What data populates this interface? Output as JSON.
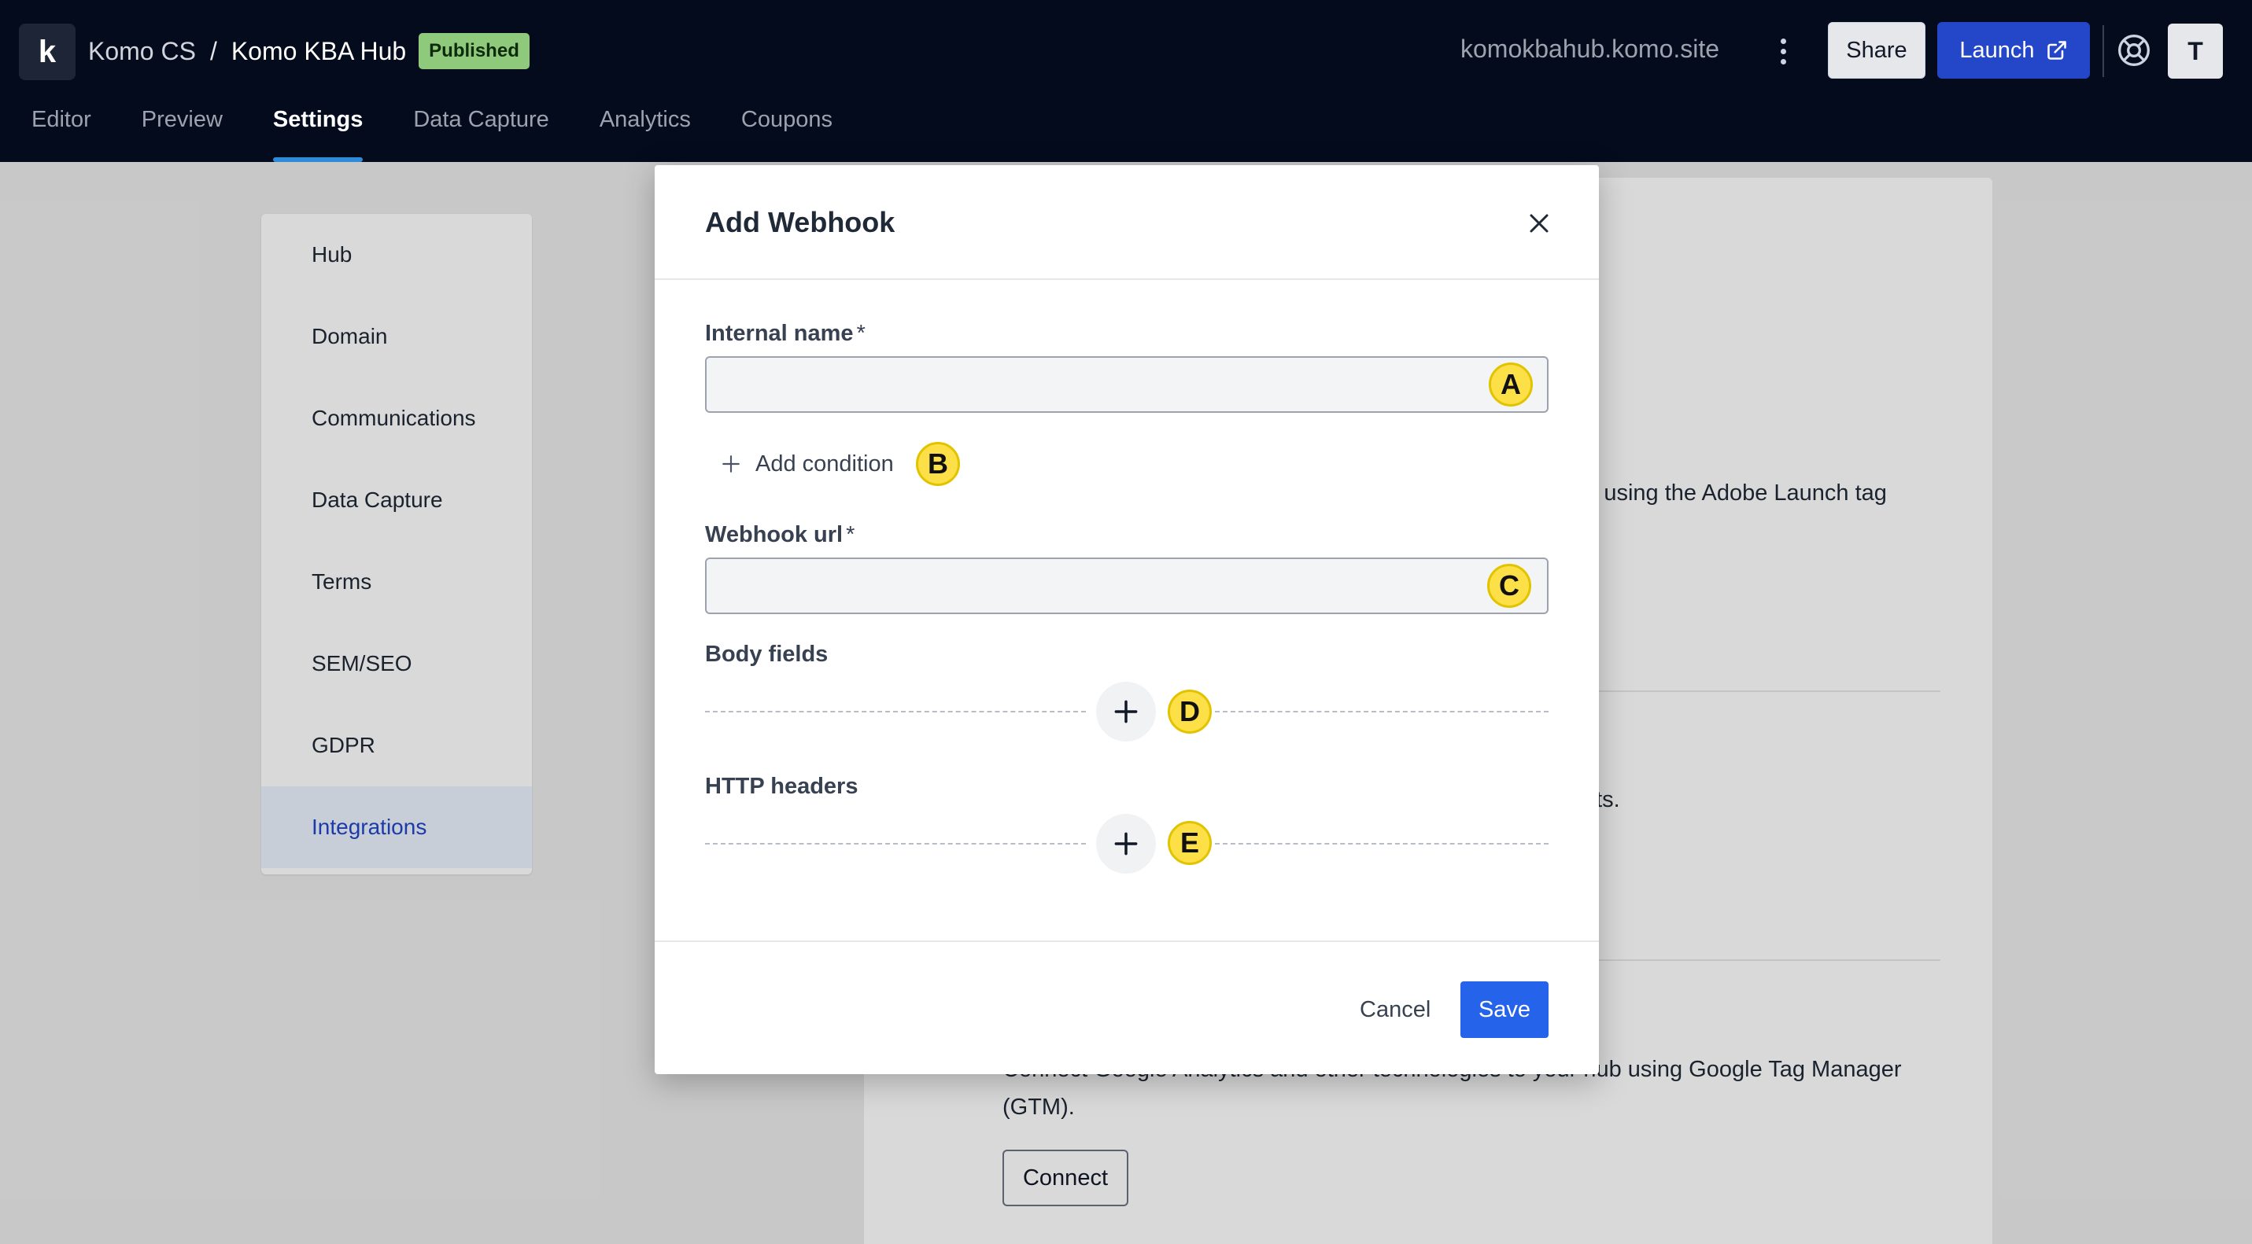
{
  "header": {
    "logo_letter": "k",
    "org": "Komo CS",
    "separator": "/",
    "hub_name": "Komo KBA Hub",
    "status_badge": "Published",
    "site_url": "komokbahub.komo.site",
    "share_label": "Share",
    "launch_label": "Launch",
    "avatar_initial": "T"
  },
  "tabs": [
    {
      "label": "Editor",
      "active": false
    },
    {
      "label": "Preview",
      "active": false
    },
    {
      "label": "Settings",
      "active": true
    },
    {
      "label": "Data Capture",
      "active": false
    },
    {
      "label": "Analytics",
      "active": false
    },
    {
      "label": "Coupons",
      "active": false
    }
  ],
  "sidebar": {
    "items": [
      {
        "label": "Hub",
        "active": false
      },
      {
        "label": "Domain",
        "active": false
      },
      {
        "label": "Communications",
        "active": false
      },
      {
        "label": "Data Capture",
        "active": false
      },
      {
        "label": "Terms",
        "active": false
      },
      {
        "label": "SEM/SEO",
        "active": false
      },
      {
        "label": "GDPR",
        "active": false
      },
      {
        "label": "Integrations",
        "active": true
      }
    ]
  },
  "background": {
    "adobe_text": "ub using the Adobe Launch tag",
    "partial_text": "nts.",
    "gtm_text_line1": "Connect Google Analytics and other technologies to your hub using Google Tag Manager",
    "gtm_text_line2": "(GTM).",
    "connect_label": "Connect"
  },
  "modal": {
    "title": "Add Webhook",
    "internal_name_label": "Internal name",
    "required_mark": "*",
    "internal_name_value": "",
    "add_condition_label": "Add condition",
    "webhook_url_label": "Webhook url",
    "webhook_url_value": "",
    "body_fields_label": "Body fields",
    "http_headers_label": "HTTP headers",
    "cancel_label": "Cancel",
    "save_label": "Save"
  },
  "markers": {
    "a": "A",
    "b": "B",
    "c": "C",
    "d": "D",
    "e": "E"
  },
  "colors": {
    "topbar_bg": "#040b1d",
    "accent_blue": "#2563eb",
    "badge_green": "#8fca7c",
    "marker_yellow": "#fde047"
  }
}
